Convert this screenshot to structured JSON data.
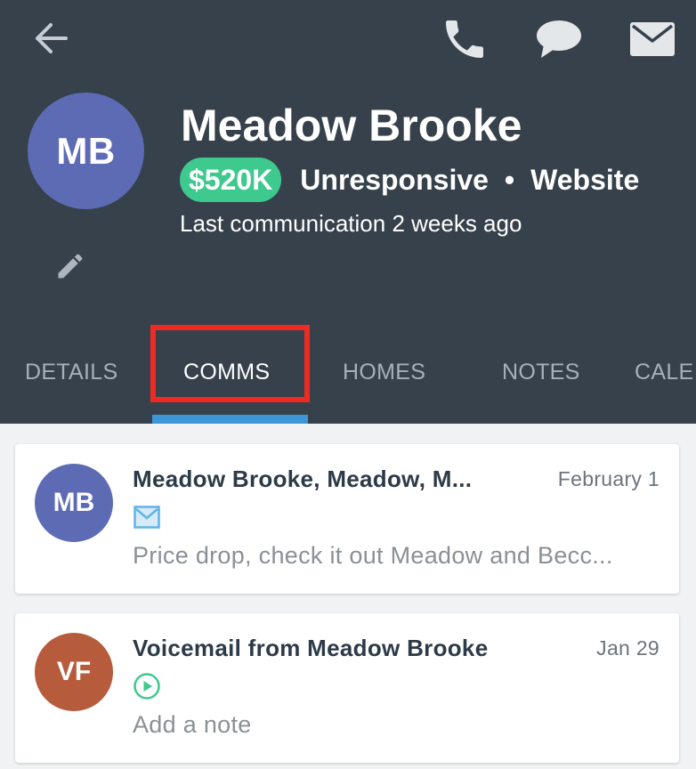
{
  "header": {
    "icons": {
      "back": "arrow-left-icon",
      "phone": "phone-icon",
      "chat": "chat-bubble-icon",
      "mail": "envelope-icon",
      "edit": "pencil-icon"
    },
    "avatar_initials": "MB",
    "avatar_color": "#5c6bb4",
    "name": "Meadow Brooke",
    "price": "$520K",
    "price_color": "#3ec98e",
    "status": "Unresponsive",
    "separator": "•",
    "source": "Website",
    "last_communication": "Last communication 2 weeks ago",
    "background_color": "#36414b"
  },
  "tabs": [
    {
      "label": "DETAILS",
      "active": false
    },
    {
      "label": "COMMS",
      "active": true
    },
    {
      "label": "HOMES",
      "active": false
    },
    {
      "label": "NOTES",
      "active": false
    },
    {
      "label": "CALE",
      "active": false
    }
  ],
  "highlight_color": "#ee2a22",
  "tab_indicator_color": "#3d97d7",
  "communications": [
    {
      "avatar_initials": "MB",
      "avatar_color": "#5c6bb4",
      "title": "Meadow Brooke, Meadow, M...",
      "date": "February 1",
      "type_icon": "envelope-icon",
      "snippet": "Price drop, check it out Meadow and Becc..."
    },
    {
      "avatar_initials": "VF",
      "avatar_color": "#b65c3d",
      "title": "Voicemail from Meadow Brooke",
      "date": "Jan 29",
      "type_icon": "play-circle-icon",
      "snippet": "Add a note"
    }
  ]
}
